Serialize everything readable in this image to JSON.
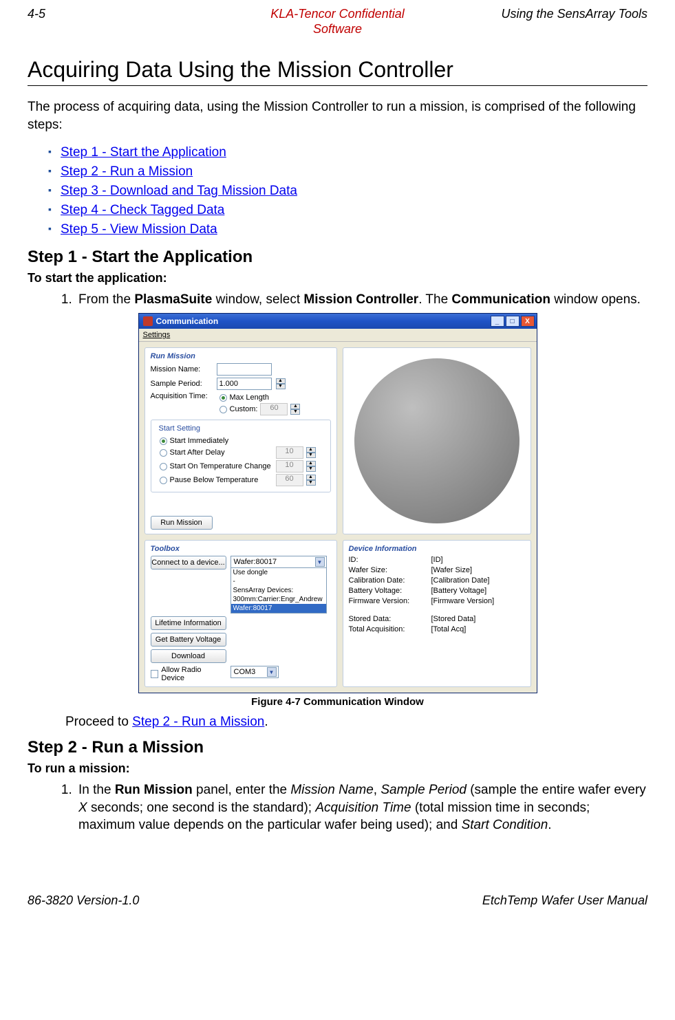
{
  "header": {
    "left": "4-5",
    "center_line1": "KLA-Tencor Confidential",
    "center_line2": "Software",
    "right": "Using the SensArray Tools"
  },
  "title": "Acquiring Data Using the Mission Controller",
  "intro": "The process of acquiring data, using the Mission Controller to run a mission, is comprised of the following steps:",
  "steps": [
    "Step 1 - Start the Application",
    "Step 2 - Run a Mission",
    "Step 3 - Download and Tag Mission Data",
    "Step 4 - Check Tagged Data",
    "Step 5 - View Mission Data"
  ],
  "section1": {
    "heading": "Step 1 - Start the Application",
    "sub": "To start the application:",
    "item1_pre": "From the ",
    "item1_b1": "PlasmaSuite",
    "item1_mid": " window, select ",
    "item1_b2": "Mission Controller",
    "item1_mid2": ". The ",
    "item1_b3": "Communication",
    "item1_post": " window opens."
  },
  "window": {
    "title": "Communication",
    "menu": "Settings",
    "run_mission": {
      "title": "Run Mission",
      "mission_name_lbl": "Mission Name:",
      "mission_name_val": "",
      "sample_period_lbl": "Sample Period:",
      "sample_period_val": "1.000",
      "acq_time_lbl": "Acquisition Time:",
      "acq_max": "Max Length",
      "acq_custom": "Custom:",
      "acq_custom_val": "60",
      "start_setting": {
        "legend": "Start Setting",
        "opt1": "Start Immediately",
        "opt2": "Start After Delay",
        "opt2_val": "10",
        "opt3": "Start On Temperature Change",
        "opt3_val": "10",
        "opt4": "Pause Below Temperature",
        "opt4_val": "60"
      },
      "run_btn": "Run Mission"
    },
    "toolbox": {
      "title": "Toolbox",
      "connect_btn": "Connect to a device...",
      "combo_val": "Wafer:80017",
      "dd1": "Use dongle",
      "dd2": "-",
      "dd3": "SensArray Devices:",
      "dd4": "300mm:Carrier:Engr_Andrew",
      "dd5": "Wafer:80017",
      "lifetime_btn": "Lifetime Information",
      "battery_btn": "Get Battery Voltage",
      "download_btn": "Download",
      "allow_radio": "Allow Radio Device",
      "com_val": "COM3"
    },
    "devinfo": {
      "title": "Device Information",
      "rows": [
        {
          "k": "ID:",
          "v": "[ID]"
        },
        {
          "k": "Wafer Size:",
          "v": "[Wafer Size]"
        },
        {
          "k": "Calibration Date:",
          "v": "[Calibration Date]"
        },
        {
          "k": "Battery Voltage:",
          "v": "[Battery Voltage]"
        },
        {
          "k": "Firmware Version:",
          "v": "[Firmware Version]"
        },
        {
          "k": "Stored Data:",
          "v": "[Stored Data]"
        },
        {
          "k": "Total Acquisition:",
          "v": "[Total Acq]"
        }
      ]
    }
  },
  "figure_caption": "Figure 4-7 Communication Window",
  "proceed_pre": "Proceed to ",
  "proceed_link": "Step 2 - Run a Mission",
  "proceed_post": ".",
  "section2": {
    "heading": "Step 2 - Run a Mission",
    "sub": "To run a mission:",
    "item1_p1": "In the ",
    "item1_b1": "Run Mission",
    "item1_p2": " panel, enter the ",
    "item1_i1": "Mission Name",
    "item1_p3": ", ",
    "item1_i2": "Sample Period",
    "item1_p4": " (sample the entire wafer every ",
    "item1_i3": "X",
    "item1_p5": " seconds; one second is the standard); ",
    "item1_i4": "Acquisition Time",
    "item1_p6": " (total mission time in seconds; maximum value depends on the particular wafer being used); and ",
    "item1_i5": "Start Condition",
    "item1_p7": "."
  },
  "footer": {
    "left": "86-3820 Version-1.0",
    "right": "EtchTemp Wafer User Manual"
  }
}
